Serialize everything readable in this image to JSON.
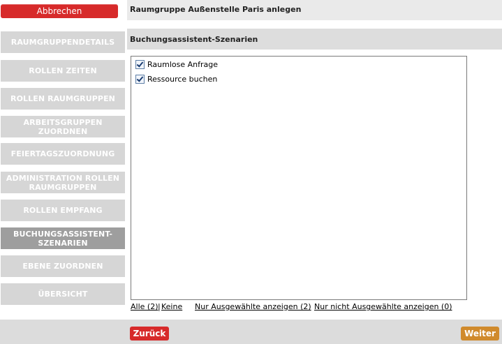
{
  "sidebar": {
    "cancel_label": "Abbrechen",
    "items": [
      {
        "label": "RAUMGRUPPENDETAILS"
      },
      {
        "label": "ROLLEN ZEITEN"
      },
      {
        "label": "ROLLEN RAUMGRUPPEN"
      },
      {
        "label": "ARBEITSGRUPPEN ZUORDNEN"
      },
      {
        "label": "FEIERTAGSZUORDNUNG"
      },
      {
        "label": "ADMINISTRATION ROLLEN RAUMGRUPPEN"
      },
      {
        "label": "ROLLEN EMPFANG"
      },
      {
        "label": "BUCHUNGSASSISTENT-SZENARIEN",
        "active": true
      },
      {
        "label": "EBENE ZUORDNEN"
      },
      {
        "label": "ÜBERSICHT"
      }
    ]
  },
  "header": {
    "title": "Raumgruppe Außenstelle Paris anlegen"
  },
  "section": {
    "title": "Buchungsassistent-Szenarien"
  },
  "options": [
    {
      "label": "Raumlose Anfrage",
      "checked": true
    },
    {
      "label": "Ressource buchen",
      "checked": true
    }
  ],
  "links": {
    "all": "Alle (2)",
    "separator": "|",
    "none": "Keine",
    "show_selected": "Nur Ausgewählte anzeigen (2)",
    "show_unselected": "Nur nicht Ausgewählte anzeigen (0)"
  },
  "footer": {
    "back_label": "Zurück",
    "next_label": "Weiter"
  },
  "colors": {
    "primary_red": "#d72a2a",
    "next_orange": "#d08a2c",
    "nav_gray": "#d6d6d6",
    "nav_active": "#9e9e9e"
  }
}
